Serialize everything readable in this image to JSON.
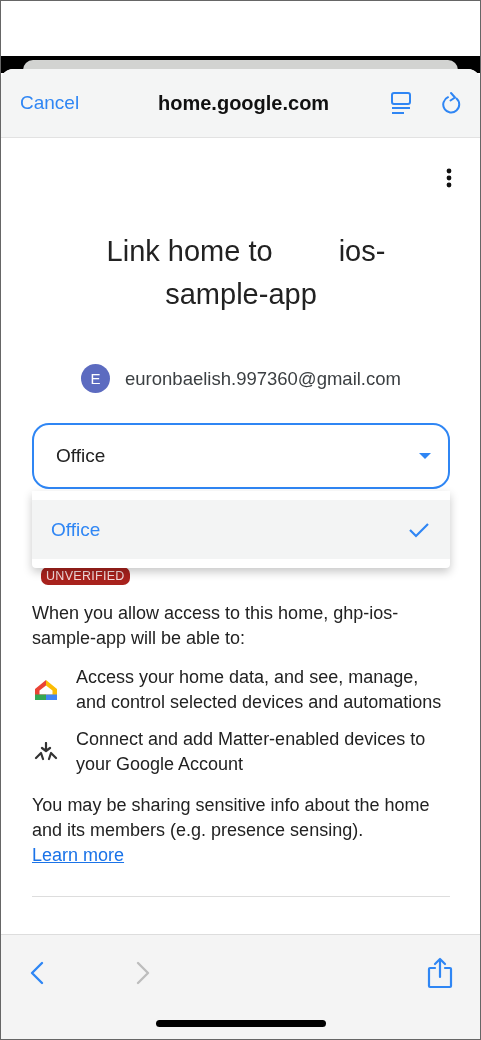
{
  "browser_header": {
    "cancel": "Cancel",
    "url": "home.google.com"
  },
  "title": {
    "lead": "Link home to",
    "tail_lines": [
      "ios-",
      "sample-app"
    ]
  },
  "account": {
    "avatar_letter": "E",
    "email": "euronbaelish.997360@gmail.com"
  },
  "home_select": {
    "value": "Office",
    "expanded": true,
    "options": [
      {
        "label": "Office",
        "selected": true
      }
    ]
  },
  "badge": "UNVERIFIED",
  "intro": "When you allow access to this home, ghp-ios-sample-app will be able to:",
  "permissions": [
    {
      "kind": "home",
      "text": "Access your home data, and see, manage, and control selected devices and automations"
    },
    {
      "kind": "matter",
      "text": "Connect and add Matter-enabled devices to your Google Account"
    }
  ],
  "notice": "You may be sharing sensitive info about the home and its members (e.g. presence sensing).",
  "learn_more": "Learn more",
  "toolbar": [
    {
      "kind": "back",
      "disabled": false
    },
    {
      "kind": "forward",
      "disabled": true
    },
    {
      "kind": "share",
      "disabled": false
    }
  ]
}
